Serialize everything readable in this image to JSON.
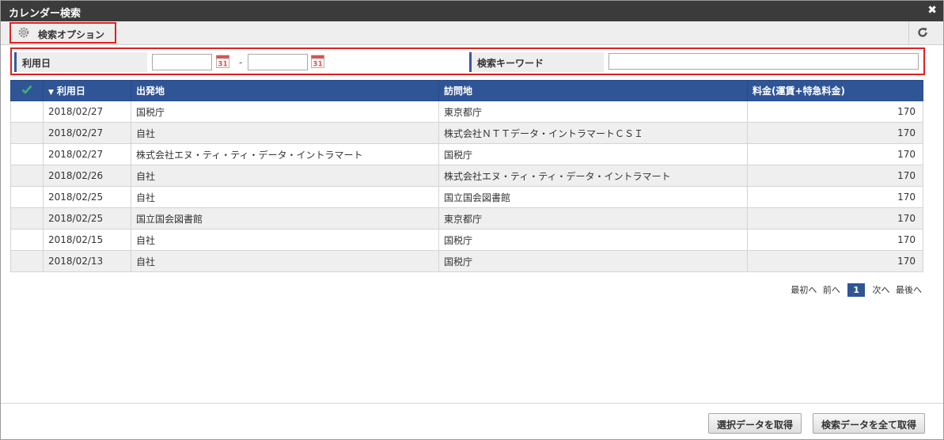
{
  "dialog": {
    "title": "カレンダー検索",
    "close_glyph": "✖"
  },
  "option_bar": {
    "label": "検索オプション",
    "gear_icon": "gear-icon",
    "reload_icon": "reload-icon"
  },
  "search": {
    "date_label": "利用日",
    "date_from": "",
    "date_to": "",
    "range_sep": "-",
    "calendar_icon": "calendar-icon",
    "keyword_label": "検索キーワード",
    "keyword_value": ""
  },
  "table": {
    "columns": [
      "",
      "利用日",
      "出発地",
      "訪問地",
      "料金(運賃+特急料金)"
    ],
    "sort_indicator": "▼",
    "rows": [
      {
        "date": "2018/02/27",
        "from": "国税庁",
        "to": "東京都庁",
        "fee": "170"
      },
      {
        "date": "2018/02/27",
        "from": "自社",
        "to": "株式会社ＮＴＴデータ・イントラマートＣＳＩ",
        "fee": "170"
      },
      {
        "date": "2018/02/27",
        "from": "株式会社エヌ・ティ・ティ・データ・イントラマート",
        "to": "国税庁",
        "fee": "170"
      },
      {
        "date": "2018/02/26",
        "from": "自社",
        "to": "株式会社エヌ・ティ・ティ・データ・イントラマート",
        "fee": "170"
      },
      {
        "date": "2018/02/25",
        "from": "自社",
        "to": "国立国会図書館",
        "fee": "170"
      },
      {
        "date": "2018/02/25",
        "from": "国立国会図書館",
        "to": "東京都庁",
        "fee": "170"
      },
      {
        "date": "2018/02/15",
        "from": "自社",
        "to": "国税庁",
        "fee": "170"
      },
      {
        "date": "2018/02/13",
        "from": "自社",
        "to": "国税庁",
        "fee": "170"
      }
    ]
  },
  "pager": {
    "first": "最初へ",
    "prev": "前へ",
    "current": "1",
    "next": "次へ",
    "last": "最後へ"
  },
  "footer": {
    "get_selected": "選択データを取得",
    "get_all": "検索データを全て取得"
  },
  "colors": {
    "header_blue": "#2f5597",
    "highlight_red": "#e02020",
    "check_green": "#3cb371"
  }
}
